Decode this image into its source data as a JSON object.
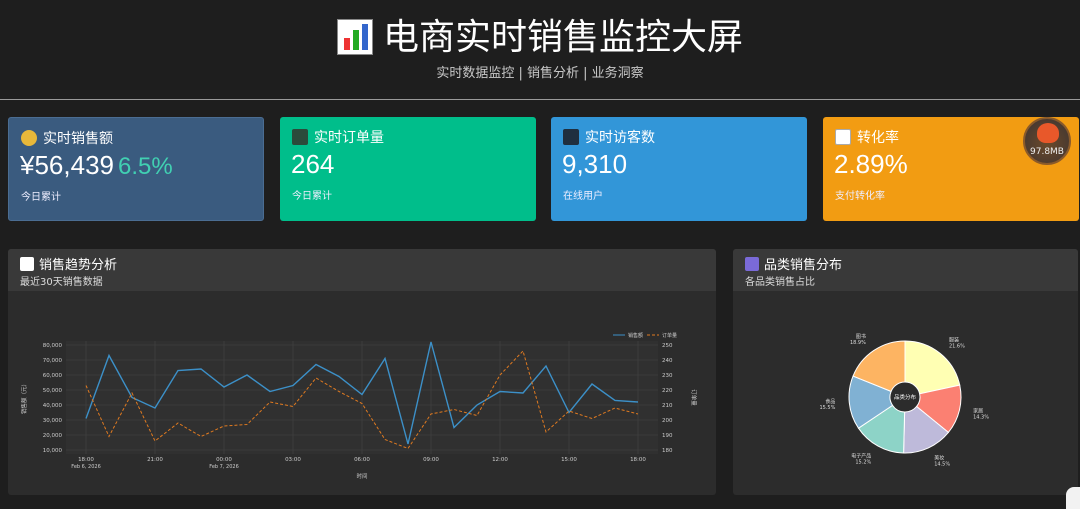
{
  "header": {
    "title": "电商实时销售监控大屏",
    "subtitle": "实时数据监控 | 销售分析 | 业务洞察",
    "title_icon": "bar-chart-icon"
  },
  "cards": [
    {
      "label": "实时销售额",
      "icon": "money-bag-icon",
      "value": "¥56,439",
      "pct": "6.5%",
      "note": "今日累计"
    },
    {
      "label": "实时订单量",
      "icon": "shopping-cart-icon",
      "value": "264",
      "note": "今日累计"
    },
    {
      "label": "实时访客数",
      "icon": "users-icon",
      "value": "9,310",
      "note": "在线用户"
    },
    {
      "label": "转化率",
      "icon": "trend-chart-icon",
      "value": "2.89%",
      "note": "支付转化率",
      "badge": "97.8MB"
    }
  ],
  "trend_panel": {
    "title": "销售趋势分析",
    "subtitle": "最近30天销售数据",
    "icon": "trend-chart-icon"
  },
  "category_panel": {
    "title": "品类销售分布",
    "subtitle": "各品类销售占比",
    "icon": "bar-chart-icon"
  },
  "colors": {
    "sales": "#3c90c8",
    "orders": "#e07a20",
    "card1": "#3a5b7f",
    "card2": "#00be8b",
    "card3": "#3296d8",
    "card4": "#f29c12"
  },
  "chart_data": [
    {
      "type": "line",
      "title": "",
      "xlabel": "时间",
      "ylabel": "销售额（元）",
      "y2label": "订单量",
      "ylim": [
        10000,
        80000
      ],
      "y2lim": [
        180,
        250
      ],
      "x_ticks": [
        {
          "label": "18:00",
          "sub": "Feb 6, 2026",
          "hour": 18
        },
        {
          "label": "21:00",
          "sub": "",
          "hour": 21
        },
        {
          "label": "00:00",
          "sub": "Feb 7, 2026",
          "hour": 24
        },
        {
          "label": "03:00",
          "sub": "",
          "hour": 27
        },
        {
          "label": "06:00",
          "sub": "",
          "hour": 30
        },
        {
          "label": "09:00",
          "sub": "",
          "hour": 33
        },
        {
          "label": "12:00",
          "sub": "",
          "hour": 36
        },
        {
          "label": "15:00",
          "sub": "",
          "hour": 39
        },
        {
          "label": "18:00",
          "sub": "",
          "hour": 42
        }
      ],
      "y_ticks": [
        "10,000",
        "20,000",
        "30,000",
        "40,000",
        "50,000",
        "60,000",
        "70,000",
        "80,000"
      ],
      "y2_ticks": [
        "180",
        "190",
        "200",
        "210",
        "220",
        "230",
        "240",
        "250"
      ],
      "x_hours": [
        18,
        19,
        20,
        21,
        22,
        23,
        24,
        25,
        26,
        27,
        28,
        29,
        30,
        31,
        32,
        33,
        34,
        35,
        36,
        37,
        38,
        39,
        40,
        41,
        42
      ],
      "series": [
        {
          "name": "销售额",
          "axis": "left",
          "values": [
            31000,
            73000,
            45000,
            38000,
            63000,
            64000,
            52000,
            60000,
            49000,
            53000,
            67000,
            59000,
            47000,
            71000,
            14000,
            82000,
            25000,
            40000,
            49000,
            48000,
            66000,
            35000,
            54000,
            43000,
            42000
          ]
        },
        {
          "name": "订单量",
          "axis": "right",
          "values": [
            223,
            189,
            218,
            186,
            198,
            189,
            196,
            197,
            212,
            209,
            228,
            219,
            211,
            187,
            181,
            204,
            207,
            203,
            230,
            246,
            192,
            206,
            201,
            208,
            204
          ]
        }
      ]
    },
    {
      "type": "pie",
      "title": "",
      "center_label": "品类分布",
      "slices": [
        {
          "name": "服装",
          "pct": "21.6%",
          "value": 21.6,
          "color": "#ffffb3"
        },
        {
          "name": "家居",
          "pct": "14.3%",
          "value": 14.3,
          "color": "#fb8072"
        },
        {
          "name": "美妆",
          "pct": "14.5%",
          "value": 14.5,
          "color": "#bebada"
        },
        {
          "name": "电子产品",
          "pct": "15.2%",
          "value": 15.2,
          "color": "#8dd3c7"
        },
        {
          "name": "食品",
          "pct": "15.5%",
          "value": 15.5,
          "color": "#80b1d3"
        },
        {
          "name": "图书",
          "pct": "18.9%",
          "value": 18.9,
          "color": "#fdb462"
        }
      ]
    }
  ]
}
